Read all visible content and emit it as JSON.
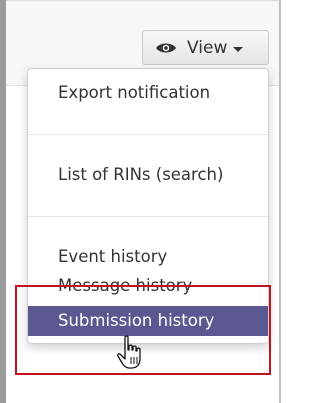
{
  "toolbar": {
    "view_label": "View"
  },
  "menu": {
    "items": [
      {
        "label": "Export notification"
      },
      {
        "label": "List of RINs (search)"
      },
      {
        "label": "Event history"
      },
      {
        "label": "Message history"
      },
      {
        "label": "Submission history"
      }
    ],
    "active_label": "Submission history"
  },
  "icons": {
    "view": "eye-icon",
    "dropdown": "caret-down-icon",
    "pointer": "hand-cursor-icon"
  },
  "colors": {
    "active_item_bg": "#5b5791",
    "highlight_border": "#c1121f"
  }
}
